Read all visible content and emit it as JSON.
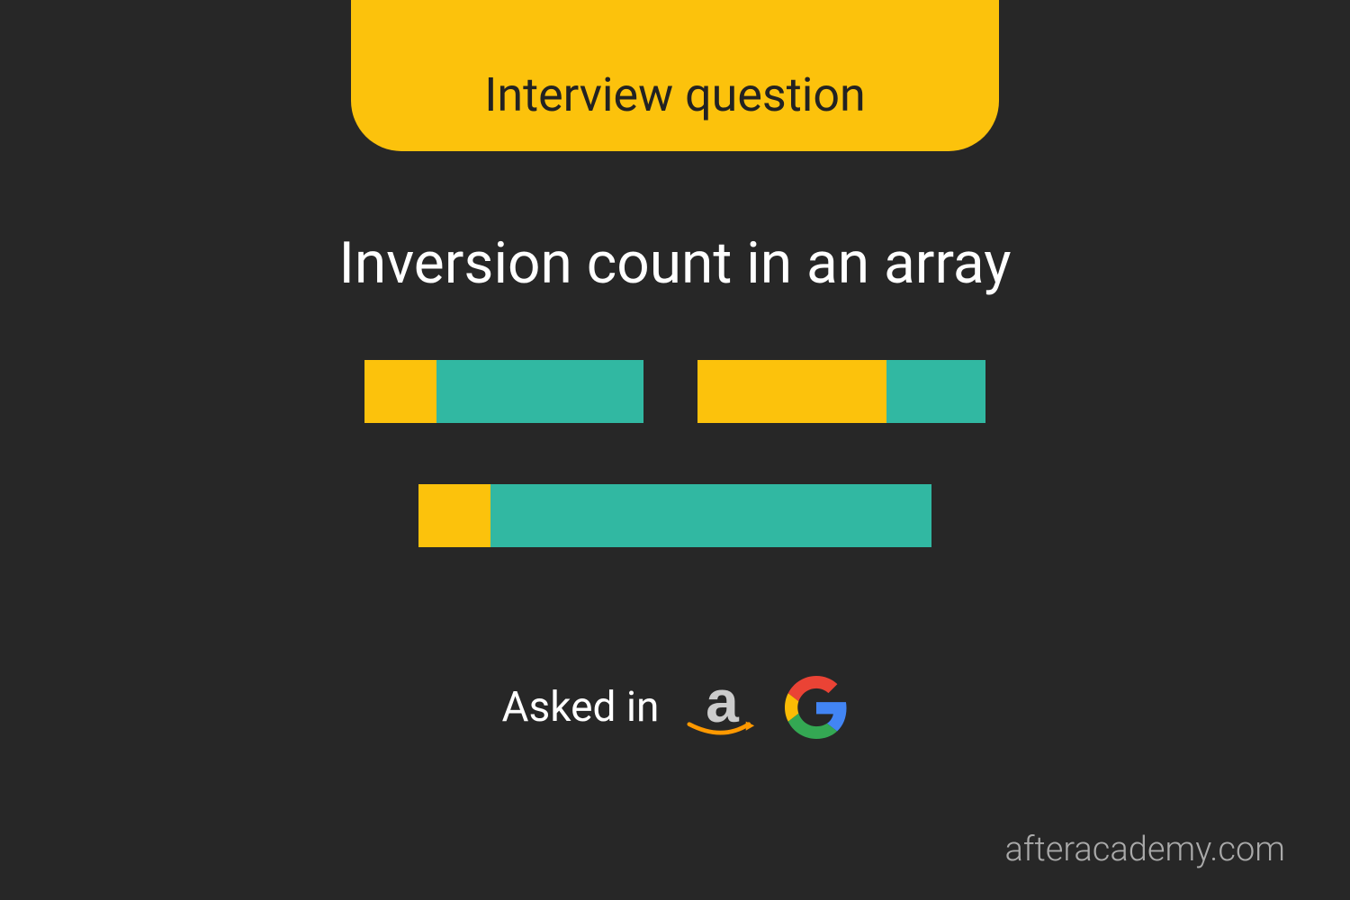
{
  "header": {
    "tab_label": "Interview question"
  },
  "title": "Inversion count in an array",
  "asked_in": {
    "label": "Asked in",
    "companies": [
      "amazon",
      "google"
    ]
  },
  "footer": {
    "site": "afteracademy.com"
  }
}
